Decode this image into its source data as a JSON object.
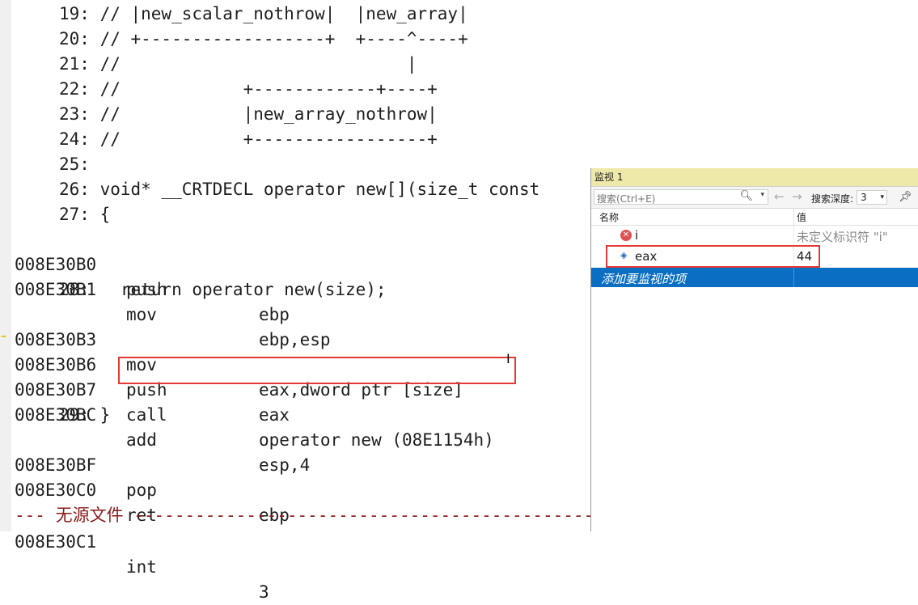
{
  "code": {
    "src_lines": [
      {
        "text": "19: // |new_scalar_nothrow|  |new_array|"
      },
      {
        "text": "20: // +------------------+  +----^----+"
      },
      {
        "text": "21: //                            |"
      },
      {
        "text": "22: //            +------------+----+"
      },
      {
        "text": "23: //            |new_array_nothrow|"
      },
      {
        "text": "24: //            +-----------------+"
      },
      {
        "text": "25:"
      },
      {
        "text": "26: void* __CRTDECL operator new[](size_t const"
      },
      {
        "text": "27: {"
      }
    ],
    "asm1": [
      {
        "addr": "008E30B0",
        "op": "push",
        "arg": "ebp"
      },
      {
        "addr": "008E30B1",
        "op": "mov",
        "arg": "ebp,esp"
      }
    ],
    "line28": "28:   return operator new(size);",
    "asm2": [
      {
        "addr": "008E30B3",
        "op": "mov",
        "arg": "eax,dword ptr [size]"
      },
      {
        "addr": "008E30B6",
        "op": "push",
        "arg": "eax"
      },
      {
        "addr": "008E30B7",
        "op": "call",
        "arg": "operator new (08E1154h)"
      },
      {
        "addr": "008E30BC",
        "op": "add",
        "arg": "esp,4"
      }
    ],
    "line29": "29: }",
    "asm3": [
      {
        "addr": "008E30BF",
        "op": "pop",
        "arg": "ebp"
      },
      {
        "addr": "008E30C0",
        "op": "ret",
        "arg": ""
      }
    ],
    "no_source_prefix": "---",
    "no_source_label": "无源文件",
    "no_source_suffix": "-------------------------------------------------",
    "asm4": [
      {
        "addr": "008E30C1",
        "op": "int",
        "arg": "3"
      }
    ]
  },
  "watch": {
    "title": "监视 1",
    "search_placeholder": "搜索(Ctrl+E)",
    "depth_label": "搜索深度:",
    "depth_value": "3",
    "col_name": "名称",
    "col_value": "值",
    "rows": [
      {
        "name": "i",
        "value": "未定义标识符 \"i\"",
        "icon": "error-icon"
      },
      {
        "name": "eax",
        "value": "44",
        "icon": "variable-icon"
      }
    ],
    "add_placeholder": "添加要监视的项"
  }
}
